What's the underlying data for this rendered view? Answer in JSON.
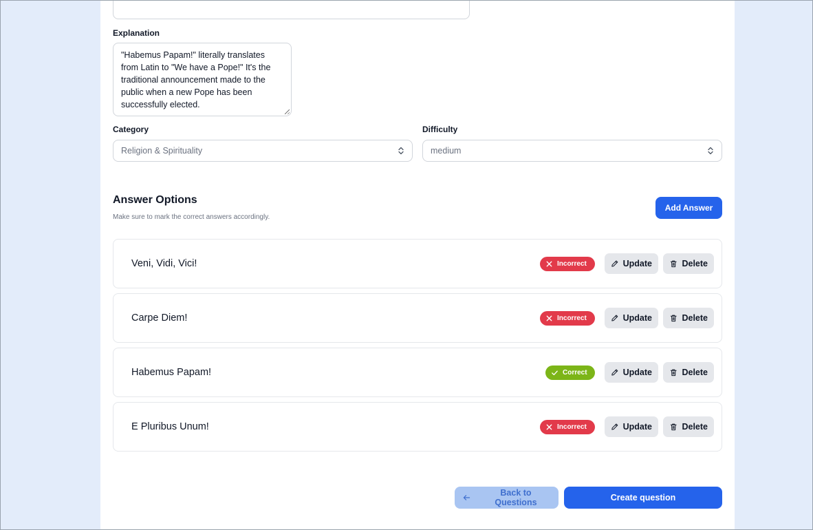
{
  "form": {
    "explanation_label": "Explanation",
    "explanation_value": "\"Habemus Papam!\" literally translates from Latin to \"We have a Pope!\" It's the traditional announcement made to the public when a new Pope has been successfully elected.",
    "category_label": "Category",
    "category_value": "Religion & Spirituality",
    "difficulty_label": "Difficulty",
    "difficulty_value": "medium"
  },
  "answers_section": {
    "title": "Answer Options",
    "subtitle": "Make sure to mark the correct answers accordingly.",
    "add_label": "Add Answer",
    "update_label": "Update",
    "delete_label": "Delete",
    "items": [
      {
        "text": "Veni, Vidi, Vici!",
        "status": "Incorrect",
        "status_icon": "x-icon"
      },
      {
        "text": "Carpe Diem!",
        "status": "Incorrect",
        "status_icon": "x-icon"
      },
      {
        "text": "Habemus Papam!",
        "status": "Correct",
        "status_icon": "check-icon"
      },
      {
        "text": "E Pluribus Unum!",
        "status": "Incorrect",
        "status_icon": "x-icon"
      }
    ]
  },
  "footer": {
    "back_label": "Back to Questions",
    "create_label": "Create question"
  },
  "colors": {
    "page_background": "#e3ecfa",
    "primary": "#2563eb",
    "incorrect": "#e23a4a",
    "correct": "#7cb518",
    "secondary_button": "#e5e7eb",
    "back_button": "#a9c5f2"
  }
}
